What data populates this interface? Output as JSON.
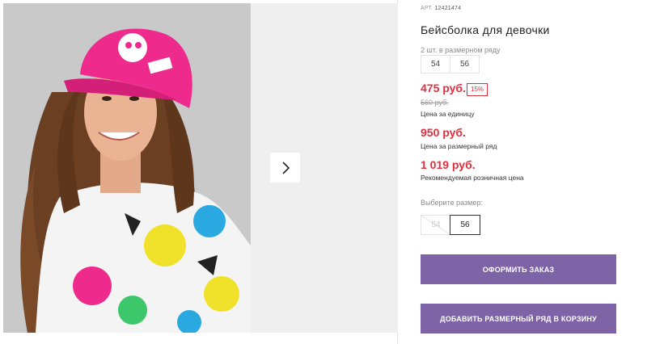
{
  "gallery": {
    "photo_alt": "Бейсболка для девочки",
    "next_icon": "chevron-right-icon"
  },
  "product": {
    "sku_label": "АРТ.",
    "sku": "12421474",
    "title": "Бейсболка для девочки",
    "pack_label": "2 шт. в размерном ряду",
    "pack_sizes": [
      "54",
      "56"
    ]
  },
  "prices": {
    "unit_price": "475 руб.",
    "discount": "15%",
    "old_price": "560 руб.",
    "unit_note": "Цена за единицу",
    "pack_price": "950 руб.",
    "pack_note": "Цена за размерный ряд",
    "retail_price": "1 019 руб.",
    "retail_note": "Рекомендуемая розничная цена"
  },
  "sizes": {
    "label": "Выберите размер:",
    "options": [
      {
        "value": "54",
        "available": false
      },
      {
        "value": "56",
        "available": true,
        "selected": true
      }
    ]
  },
  "actions": {
    "order_label": "ОФОРМИТЬ ЗАКАЗ",
    "add_to_cart_label": "ДОБАВИТЬ РАЗМЕРНЫЙ РЯД В КОРЗИНУ"
  },
  "colors": {
    "accent": "#7e63a6",
    "price": "#e0303e",
    "cap": "#ee2a8c"
  }
}
